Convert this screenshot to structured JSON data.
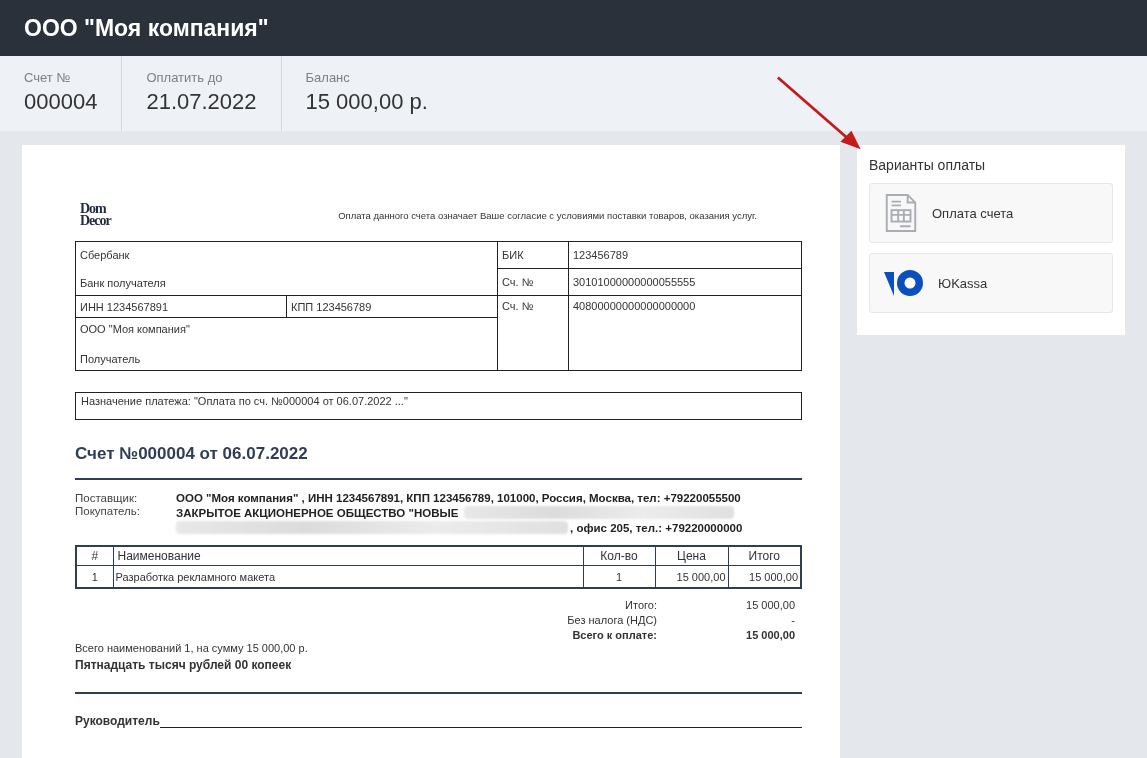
{
  "header": {
    "title": "ООО \"Моя компания\""
  },
  "summary": [
    {
      "label": "Счет №",
      "value": "000004"
    },
    {
      "label": "Оплатить до",
      "value": "21.07.2022"
    },
    {
      "label": "Баланс",
      "value": "15 000,00 р."
    }
  ],
  "invoice": {
    "logo": {
      "line_1": "Dom",
      "line_2": "Decor"
    },
    "notice": "Оплата данного счета означает Ваше согласие с условиями поставки товаров, оказания услуг.",
    "bank_details": {
      "bank_name": "Сбербанк",
      "bank_caption": "Банк получателя",
      "bik_label": "БИК",
      "bik": "123456789",
      "corr_label": "Сч. №",
      "corr_account": "30101000000000055555",
      "inn": "ИНН 1234567891",
      "kpp": "КПП 123456789",
      "account_label": "Сч. №",
      "account": "40800000000000000000",
      "recipient": "ООО \"Моя компания\"",
      "recipient_caption": "Получатель"
    },
    "payment_purpose": "Назначение платежа: \"Оплата по сч. №000004 от 06.07.2022 ...\"",
    "title": "Счет №000004 от 06.07.2022",
    "supplier": {
      "label": "Поставщик:",
      "value": "ООО \"Моя компания\" , ИНН 1234567891, КПП 123456789, 101000, Россия, Москва, тел: +79220055500"
    },
    "buyer": {
      "label": "Покупатель:",
      "value_start": "ЗАКРЫТОЕ АКЦИОНЕРНОЕ ОБЩЕСТВО \"НОВЫЕ",
      "value_end": ", офис 205, тел.: +79220000000"
    },
    "items_table": {
      "columns": [
        "#",
        "Наименование",
        "Кол-во",
        "Цена",
        "Итого"
      ],
      "rows": [
        [
          "1",
          "Разработка рекламного макета",
          "1",
          "15 000,00",
          "15 000,00"
        ]
      ]
    },
    "totals": [
      {
        "label": "Итого:",
        "value": "15 000,00",
        "bold": false
      },
      {
        "label": "Без налога (НДС)",
        "value": "-",
        "bold": false
      },
      {
        "label": "Всего к оплате:",
        "value": "15 000,00",
        "bold": true
      }
    ],
    "summary_line": "Всего наименований 1, на сумму 15 000,00 р.",
    "amount_in_words": "Пятнадцать тысяч рублей 00 копеек",
    "signature_label": "Руководитель"
  },
  "payment_options": {
    "title": "Варианты оплаты",
    "options": [
      {
        "kind": "invoice",
        "label": "Оплата счета"
      },
      {
        "kind": "yookassa",
        "label": "ЮKassa"
      }
    ]
  }
}
